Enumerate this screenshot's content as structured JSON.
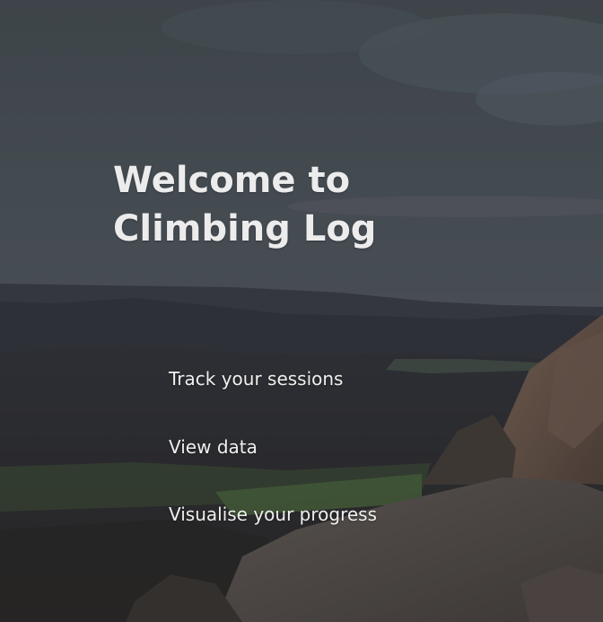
{
  "hero": {
    "title_line1": "Welcome to",
    "title_line2": "Climbing Log",
    "background": "moorland-landscape-photo"
  },
  "nav": {
    "items": [
      {
        "label": "Track your sessions"
      },
      {
        "label": "View data"
      },
      {
        "label": "Visualise your progress"
      }
    ]
  },
  "colors": {
    "text": "#ececec",
    "overlay": "#2c3036"
  }
}
